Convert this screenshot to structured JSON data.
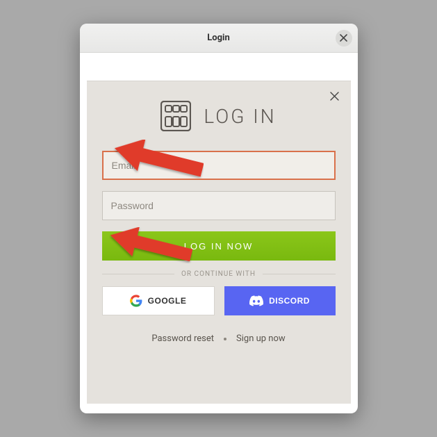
{
  "window": {
    "title": "Login"
  },
  "panel": {
    "brand_label": "LOG IN",
    "email_placeholder": "Email",
    "email_value": "",
    "password_placeholder": "Password",
    "password_value": "",
    "login_button": "LOG IN NOW",
    "continue_label": "OR CONTINUE WITH",
    "google_label": "GOOGLE",
    "discord_label": "DISCORD",
    "reset_link": "Password reset",
    "signup_link": "Sign up now"
  }
}
